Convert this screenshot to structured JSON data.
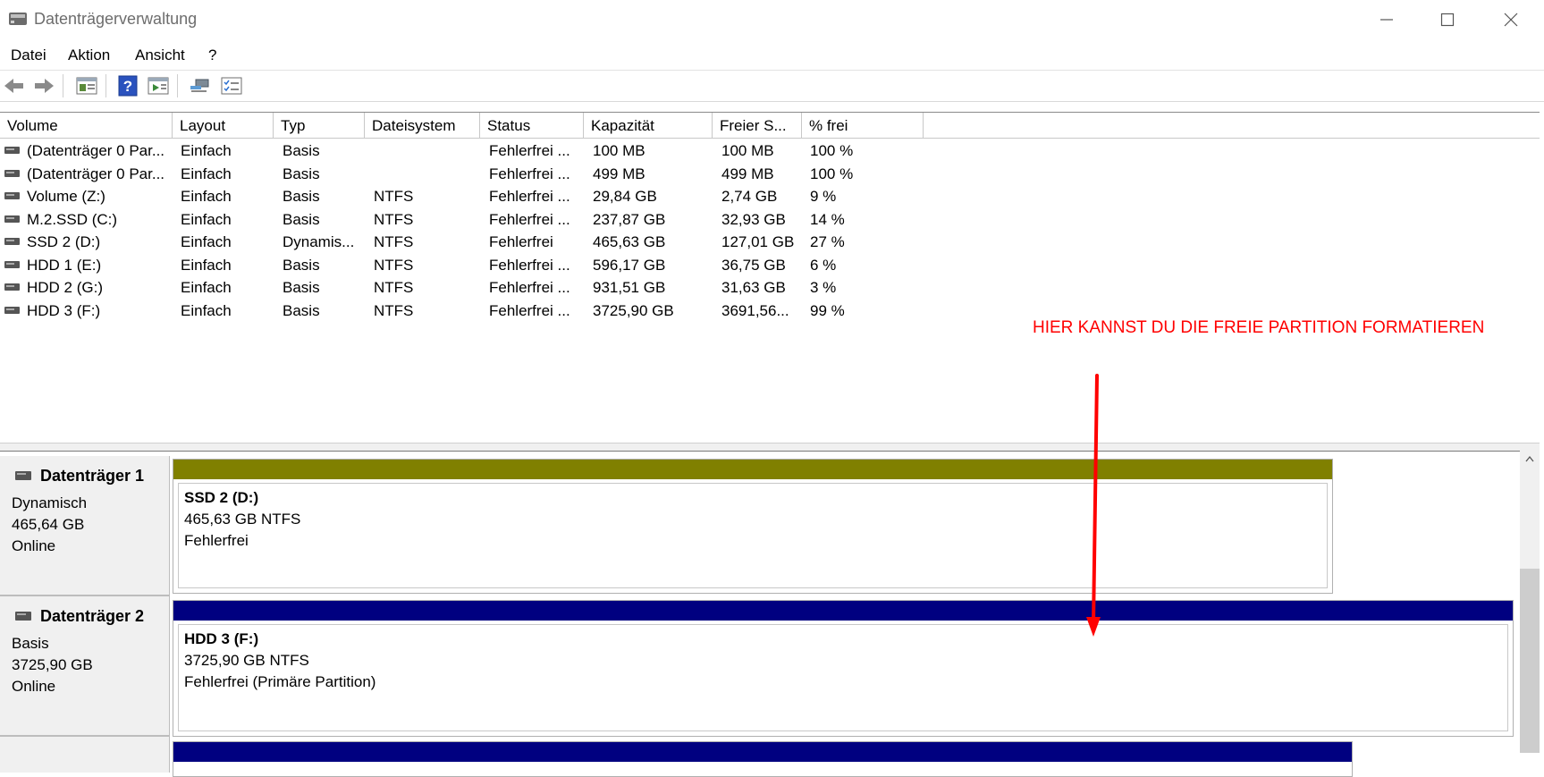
{
  "window": {
    "title": "Datenträgerverwaltung"
  },
  "menu": [
    "Datei",
    "Aktion",
    "Ansicht",
    "?"
  ],
  "toolbar": {
    "icons": [
      "back-arrow-icon",
      "forward-arrow-icon",
      "properties-icon",
      "help-icon",
      "refresh-icon",
      "connect-icon",
      "checklist-icon"
    ]
  },
  "volume_list": {
    "columns": [
      "Volume",
      "Layout",
      "Typ",
      "Dateisystem",
      "Status",
      "Kapazität",
      "Freier S...",
      "% frei"
    ],
    "rows": [
      [
        "(Datenträger 0 Par...",
        "Einfach",
        "Basis",
        "",
        "Fehlerfrei ...",
        "100 MB",
        "100 MB",
        "100 %"
      ],
      [
        "(Datenträger 0 Par...",
        "Einfach",
        "Basis",
        "",
        "Fehlerfrei ...",
        "499 MB",
        "499 MB",
        "100 %"
      ],
      [
        "Volume (Z:)",
        "Einfach",
        "Basis",
        "NTFS",
        "Fehlerfrei ...",
        "29,84 GB",
        "2,74 GB",
        "9 %"
      ],
      [
        "M.2.SSD (C:)",
        "Einfach",
        "Basis",
        "NTFS",
        "Fehlerfrei ...",
        "237,87 GB",
        "32,93 GB",
        "14 %"
      ],
      [
        "SSD 2 (D:)",
        "Einfach",
        "Dynamis...",
        "NTFS",
        "Fehlerfrei",
        "465,63 GB",
        "127,01 GB",
        "27 %"
      ],
      [
        "HDD 1 (E:)",
        "Einfach",
        "Basis",
        "NTFS",
        "Fehlerfrei ...",
        "596,17 GB",
        "36,75 GB",
        "6 %"
      ],
      [
        "HDD 2 (G:)",
        "Einfach",
        "Basis",
        "NTFS",
        "Fehlerfrei ...",
        "931,51 GB",
        "31,63 GB",
        "3 %"
      ],
      [
        "HDD 3 (F:)",
        "Einfach",
        "Basis",
        "NTFS",
        "Fehlerfrei ...",
        "3725,90 GB",
        "3691,56...",
        "99 %"
      ]
    ]
  },
  "annotation": "HIER KANNST DU DIE FREIE PARTITION FORMATIEREN",
  "disks": [
    {
      "name": "Datenträger 1",
      "type": "Dynamisch",
      "size": "465,64 GB",
      "state": "Online",
      "partition": {
        "name": "SSD 2  (D:)",
        "size_fs": "465,63 GB NTFS",
        "status": "Fehlerfrei",
        "bar_color": "#808000"
      }
    },
    {
      "name": "Datenträger 2",
      "type": "Basis",
      "size": "3725,90 GB",
      "state": "Online",
      "partition": {
        "name": "HDD 3  (F:)",
        "size_fs": "3725,90 GB NTFS",
        "status": "Fehlerfrei (Primäre Partition)",
        "bar_color": "#000080"
      }
    }
  ],
  "colors": {
    "annotation": "#ff0000",
    "dynamic_bar": "#808000",
    "primary_bar": "#000080"
  }
}
